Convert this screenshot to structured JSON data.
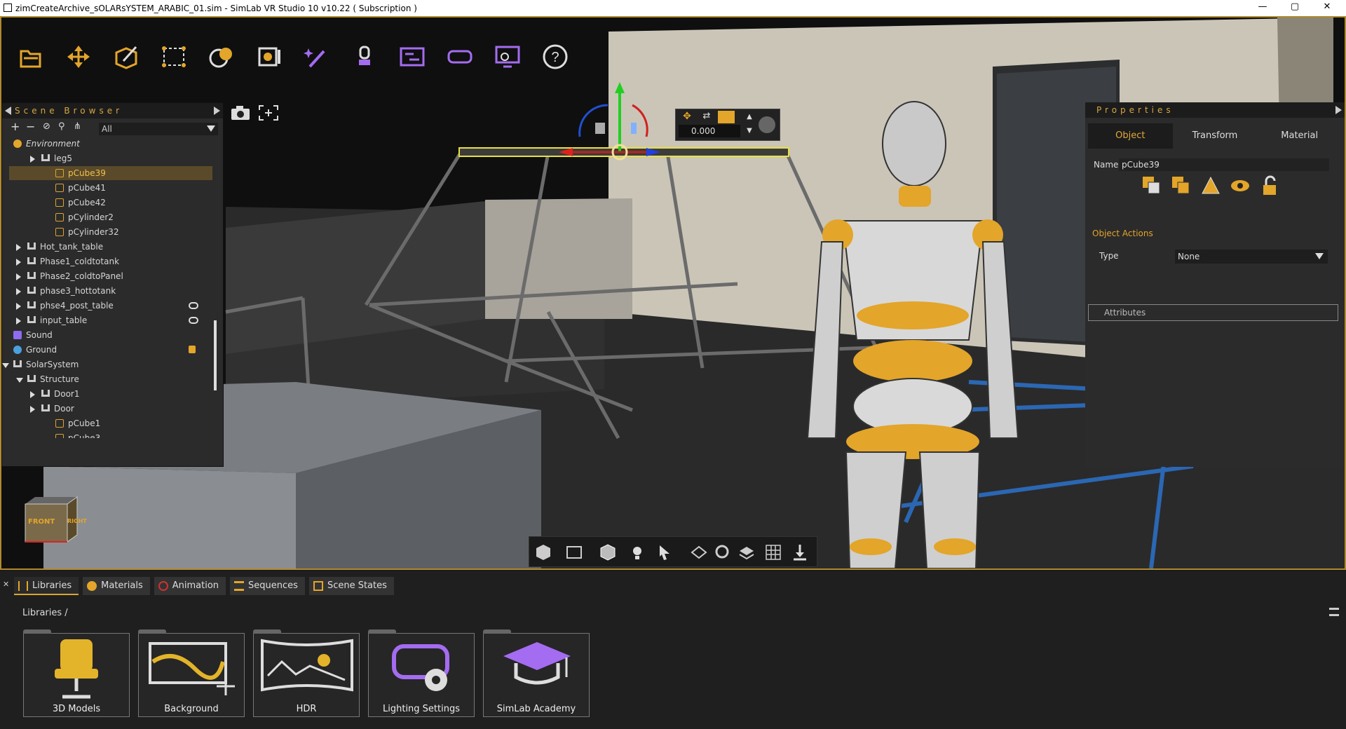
{
  "window": {
    "title": "zimCreateArchive_sOLARsYSTEM_ARABIC_01.sim - SimLab VR Studio 10 v10.22 ( Subscription )",
    "minimize": "—",
    "maximize": "▢",
    "close": "✕"
  },
  "toolbar": {
    "icons": [
      "open-file-icon",
      "move-icon",
      "edit-icon",
      "select-region-icon",
      "render-icon",
      "viewport-icon",
      "effects-wand-icon",
      "vr-controller-icon",
      "timeline-icon",
      "vr-headset-icon",
      "presentation-icon",
      "help-icon"
    ]
  },
  "scene_browser": {
    "title": "Scene Browser",
    "filter": "All",
    "items": [
      {
        "label": "Environment",
        "icon": "sun-icon",
        "indent": 0,
        "expander": "none",
        "italic": true
      },
      {
        "label": "leg5",
        "icon": "group-icon",
        "indent": 2,
        "expander": "collapsed"
      },
      {
        "label": "pCube39",
        "icon": "cube-icon",
        "indent": 3,
        "expander": "none",
        "selected": true
      },
      {
        "label": "pCube41",
        "icon": "cube-icon",
        "indent": 3,
        "expander": "none"
      },
      {
        "label": "pCube42",
        "icon": "cube-icon",
        "indent": 3,
        "expander": "none"
      },
      {
        "label": "pCylinder2",
        "icon": "cube-icon",
        "indent": 3,
        "expander": "none"
      },
      {
        "label": "pCylinder32",
        "icon": "cube-icon",
        "indent": 3,
        "expander": "none"
      },
      {
        "label": "Hot_tank_table",
        "icon": "group-icon",
        "indent": 1,
        "expander": "collapsed"
      },
      {
        "label": "Phase1_coldtotank",
        "icon": "group-icon",
        "indent": 1,
        "expander": "collapsed"
      },
      {
        "label": "Phase2_coldtoPanel",
        "icon": "group-icon",
        "indent": 1,
        "expander": "collapsed"
      },
      {
        "label": "phase3_hottotank",
        "icon": "group-icon",
        "indent": 1,
        "expander": "collapsed"
      },
      {
        "label": "phse4_post_table",
        "icon": "group-icon",
        "indent": 1,
        "expander": "collapsed",
        "flag": "eye-icon"
      },
      {
        "label": "input_table",
        "icon": "group-icon",
        "indent": 1,
        "expander": "collapsed",
        "flag": "eye-icon"
      },
      {
        "label": "Sound",
        "icon": "sound-icon",
        "indent": 0,
        "expander": "none"
      },
      {
        "label": "Ground",
        "icon": "globe-icon",
        "indent": 0,
        "expander": "none",
        "flag": "lock-icon"
      },
      {
        "label": "SolarSystem",
        "icon": "group-icon",
        "indent": 0,
        "expander": "expanded"
      },
      {
        "label": "Structure",
        "icon": "group-icon",
        "indent": 1,
        "expander": "expanded"
      },
      {
        "label": "Door1",
        "icon": "group-icon",
        "indent": 2,
        "expander": "collapsed"
      },
      {
        "label": "Door",
        "icon": "group-icon",
        "indent": 2,
        "expander": "collapsed"
      },
      {
        "label": "pCube1",
        "icon": "cube-icon",
        "indent": 3,
        "expander": "none"
      },
      {
        "label": "pCube3",
        "icon": "cube-icon",
        "indent": 3,
        "expander": "none"
      }
    ]
  },
  "gizmo": {
    "value": "0.000"
  },
  "view_cube": {
    "front": "FRONT",
    "right": "RIGHT"
  },
  "properties": {
    "title": "Properties",
    "tabs": [
      "Object",
      "Transform",
      "Material"
    ],
    "name_label": "Name",
    "name_value": "pCube39",
    "object_actions_label": "Object Actions",
    "type_label": "Type",
    "type_value": "None",
    "attributes_label": "Attributes"
  },
  "bottom": {
    "tabs": [
      "Libraries",
      "Materials",
      "Animation",
      "Sequences",
      "Scene States"
    ],
    "breadcrumb": "Libraries  /",
    "tiles": [
      "3D Models",
      "Background",
      "HDR",
      "Lighting Settings",
      "SimLab Academy"
    ]
  },
  "colors": {
    "accent": "#d9a632",
    "panel": "#2b2b2b",
    "frame": "#b08a2c"
  }
}
